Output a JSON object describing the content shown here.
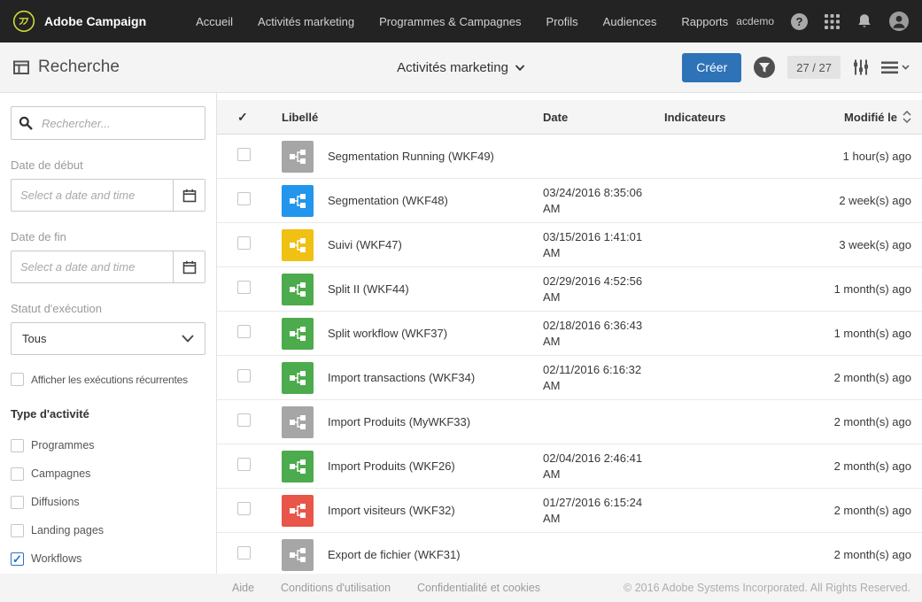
{
  "colors": {
    "topbar_bg": "#232323",
    "accent": "#2e72b8",
    "icon": {
      "gray": "#a6a6a6",
      "blue": "#2395ec",
      "yellow": "#f0c013",
      "green": "#4cab4c",
      "red": "#e8564a"
    }
  },
  "icons": {
    "topbar": [
      "campaign-logo-icon",
      "help-icon",
      "apps-grid-icon",
      "notifications-bell-icon",
      "user-avatar-icon"
    ],
    "subheader": [
      "search-page-icon",
      "chevron-down-icon",
      "filter-icon",
      "column-settings-icon",
      "list-view-icon"
    ],
    "sidebar": [
      "search-icon",
      "calendar-icon",
      "chevron-down-icon"
    ],
    "table": [
      "select-all-check-icon",
      "sort-icon",
      "workflow-icon"
    ]
  },
  "topbar": {
    "brand": "Adobe Campaign",
    "nav": [
      {
        "label": "Accueil"
      },
      {
        "label": "Activités marketing"
      },
      {
        "label": "Programmes & Campagnes"
      },
      {
        "label": "Profils"
      },
      {
        "label": "Audiences"
      },
      {
        "label": "Rapports"
      }
    ],
    "account": "acdemo"
  },
  "header": {
    "title": "Recherche",
    "context_selector": "Activités marketing",
    "create_button": "Créer",
    "counter": "27 / 27"
  },
  "sidebar": {
    "search_placeholder": "Rechercher...",
    "date_start_label": "Date de début",
    "date_start_placeholder": "Select a date and time",
    "date_end_label": "Date de fin",
    "date_end_placeholder": "Select a date and time",
    "status_label": "Statut d'exécution",
    "status_value": "Tous",
    "recurring_checkbox_label": "Afficher les exécutions récurrentes",
    "activity_type_heading": "Type d'activité",
    "activity_types": [
      {
        "label": "Programmes",
        "checked": false
      },
      {
        "label": "Campagnes",
        "checked": false
      },
      {
        "label": "Diffusions",
        "checked": false
      },
      {
        "label": "Landing pages",
        "checked": false
      },
      {
        "label": "Workflows",
        "checked": true
      }
    ]
  },
  "table": {
    "select_all_icon": "✓",
    "columns": [
      "Libellé",
      "Date",
      "Indicateurs",
      "Modifié le"
    ],
    "rows": [
      {
        "label": "Segmentation Running (WKF49)",
        "date": "",
        "indicators": "",
        "modified": "1 hour(s) ago",
        "icon_color": "gray"
      },
      {
        "label": "Segmentation (WKF48)",
        "date": "03/24/2016 8:35:06 AM",
        "indicators": "",
        "modified": "2 week(s) ago",
        "icon_color": "blue"
      },
      {
        "label": "Suivi (WKF47)",
        "date": "03/15/2016 1:41:01 AM",
        "indicators": "",
        "modified": "3 week(s) ago",
        "icon_color": "yellow"
      },
      {
        "label": "Split II (WKF44)",
        "date": "02/29/2016 4:52:56 AM",
        "indicators": "",
        "modified": "1 month(s) ago",
        "icon_color": "green"
      },
      {
        "label": "Split workflow (WKF37)",
        "date": "02/18/2016 6:36:43 AM",
        "indicators": "",
        "modified": "1 month(s) ago",
        "icon_color": "green"
      },
      {
        "label": "Import transactions (WKF34)",
        "date": "02/11/2016 6:16:32 AM",
        "indicators": "",
        "modified": "2 month(s) ago",
        "icon_color": "green"
      },
      {
        "label": "Import Produits (MyWKF33)",
        "date": "",
        "indicators": "",
        "modified": "2 month(s) ago",
        "icon_color": "gray"
      },
      {
        "label": "Import Produits (WKF26)",
        "date": "02/04/2016 2:46:41 AM",
        "indicators": "",
        "modified": "2 month(s) ago",
        "icon_color": "green"
      },
      {
        "label": "Import visiteurs (WKF32)",
        "date": "01/27/2016 6:15:24 AM",
        "indicators": "",
        "modified": "2 month(s) ago",
        "icon_color": "red"
      },
      {
        "label": "Export de fichier (WKF31)",
        "date": "",
        "indicators": "",
        "modified": "2 month(s) ago",
        "icon_color": "gray"
      }
    ]
  },
  "footer": {
    "links": [
      "Aide",
      "Conditions d'utilisation",
      "Confidentialité et cookies"
    ],
    "copyright": "© 2016 Adobe Systems Incorporated. All Rights Reserved."
  }
}
